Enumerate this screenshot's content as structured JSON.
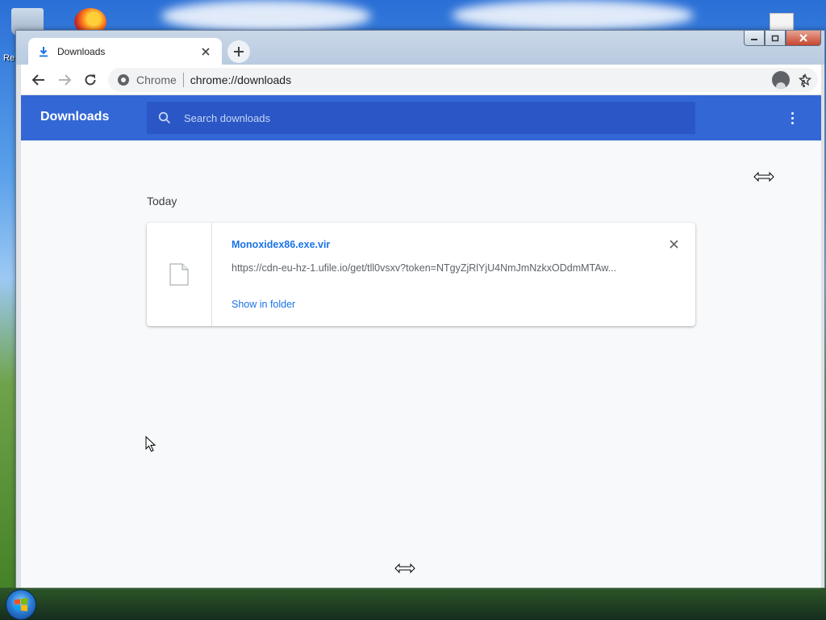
{
  "desktop": {
    "recycle_bin_label": "Re"
  },
  "browser": {
    "tab": {
      "title": "Downloads",
      "icon": "download-icon"
    },
    "toolbar": {
      "chip_label": "Chrome",
      "url": "chrome://downloads"
    }
  },
  "downloads_page": {
    "title": "Downloads",
    "search_placeholder": "Search downloads",
    "date_header": "Today",
    "items": [
      {
        "file_name": "Monoxidex86.exe.vir",
        "url": "https://cdn-eu-hz-1.ufile.io/get/tll0vsxv?token=NTgyZjRlYjU4NmJmNzkxODdmMTAw...",
        "action_label": "Show in folder"
      }
    ]
  },
  "colors": {
    "header_blue": "#3367d6",
    "link_blue": "#1a73e8",
    "page_bg": "#f8f9fa"
  }
}
